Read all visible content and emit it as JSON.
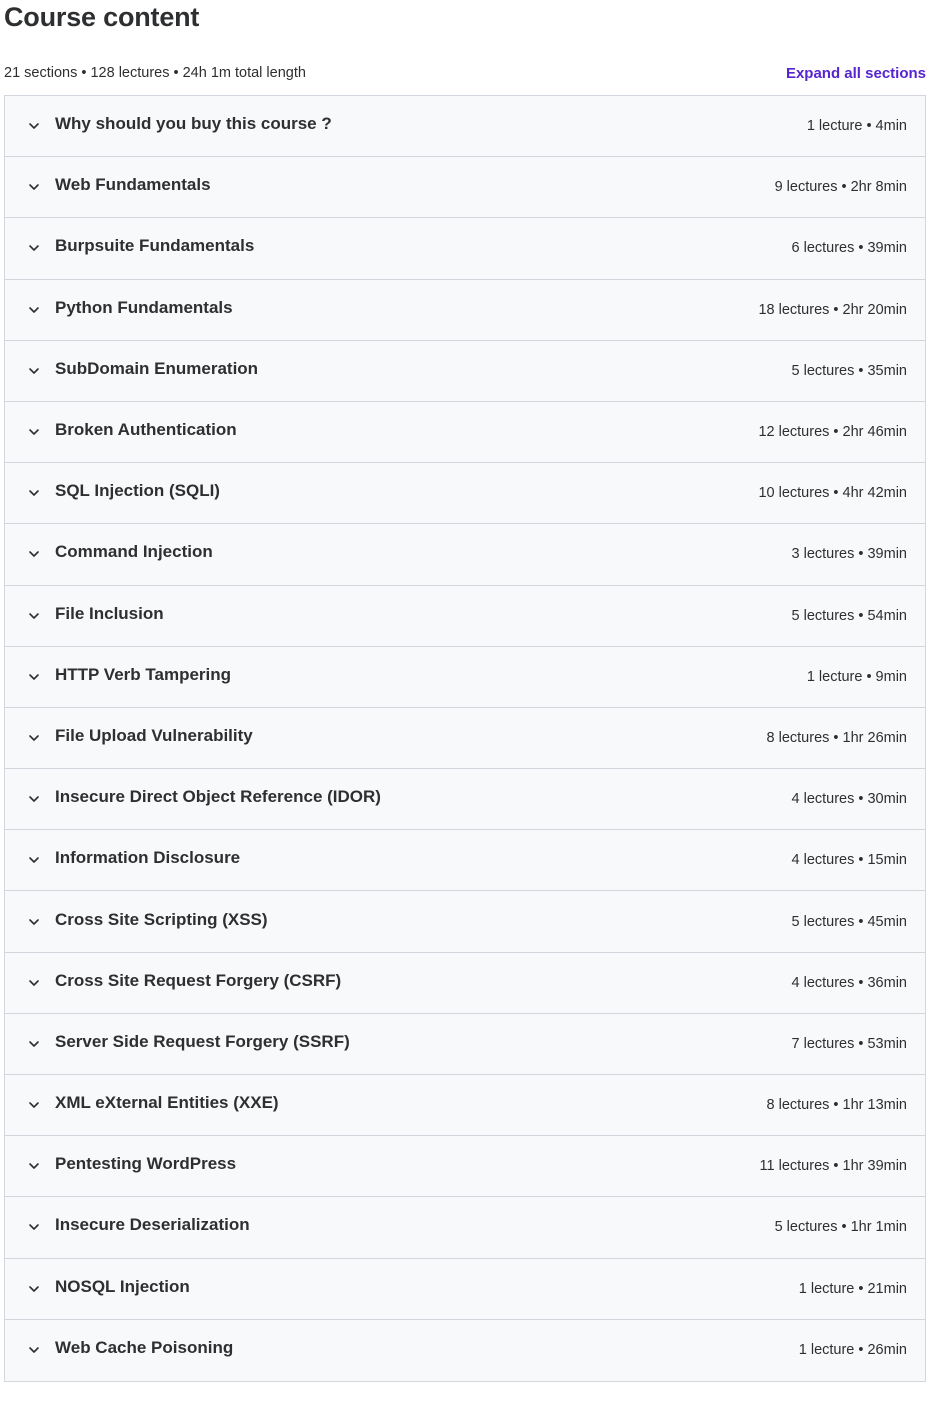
{
  "header": {
    "title": "Course content",
    "summary": "21 sections • 128 lectures • 24h 1m total length",
    "expand_all_label": "Expand all sections"
  },
  "colors": {
    "accent": "#5624d0",
    "row_background": "#f7f9fa",
    "border": "#d1d7dc",
    "text": "#2d2f31"
  },
  "icons": {
    "section_toggle": "chevron-down-icon"
  },
  "sections": [
    {
      "title": "Why should you buy this course ?",
      "meta": "1 lecture • 4min"
    },
    {
      "title": "Web Fundamentals",
      "meta": "9 lectures • 2hr 8min"
    },
    {
      "title": "Burpsuite Fundamentals",
      "meta": "6 lectures • 39min"
    },
    {
      "title": "Python Fundamentals",
      "meta": "18 lectures • 2hr 20min"
    },
    {
      "title": "SubDomain Enumeration",
      "meta": "5 lectures • 35min"
    },
    {
      "title": "Broken Authentication",
      "meta": "12 lectures • 2hr 46min"
    },
    {
      "title": "SQL Injection (SQLI)",
      "meta": "10 lectures • 4hr 42min"
    },
    {
      "title": "Command Injection",
      "meta": "3 lectures • 39min"
    },
    {
      "title": "File Inclusion",
      "meta": "5 lectures • 54min"
    },
    {
      "title": "HTTP Verb Tampering",
      "meta": "1 lecture • 9min"
    },
    {
      "title": "File Upload Vulnerability",
      "meta": "8 lectures • 1hr 26min"
    },
    {
      "title": "Insecure Direct Object Reference (IDOR)",
      "meta": "4 lectures • 30min"
    },
    {
      "title": "Information Disclosure",
      "meta": "4 lectures • 15min"
    },
    {
      "title": "Cross Site Scripting (XSS)",
      "meta": "5 lectures • 45min"
    },
    {
      "title": "Cross Site Request Forgery (CSRF)",
      "meta": "4 lectures • 36min"
    },
    {
      "title": "Server Side Request Forgery (SSRF)",
      "meta": "7 lectures • 53min"
    },
    {
      "title": "XML eXternal Entities (XXE)",
      "meta": "8 lectures • 1hr 13min"
    },
    {
      "title": "Pentesting WordPress",
      "meta": "11 lectures • 1hr 39min"
    },
    {
      "title": "Insecure Deserialization",
      "meta": "5 lectures • 1hr 1min"
    },
    {
      "title": "NOSQL Injection",
      "meta": "1 lecture • 21min"
    },
    {
      "title": "Web Cache Poisoning",
      "meta": "1 lecture • 26min"
    }
  ]
}
